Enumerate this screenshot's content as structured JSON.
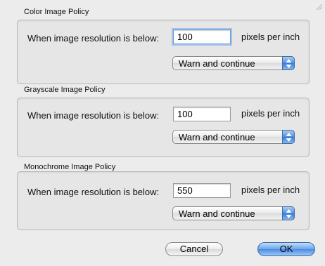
{
  "color_policy": {
    "title": "Color Image Policy",
    "label": "When image resolution is below:",
    "value": "100",
    "unit": "pixels per inch",
    "action": "Warn and continue"
  },
  "grayscale_policy": {
    "title": "Grayscale Image Policy",
    "label": "When image resolution is below:",
    "value": "100",
    "unit": "pixels per inch",
    "action": "Warn and continue"
  },
  "mono_policy": {
    "title": "Monochrome Image Policy",
    "label": "When image resolution is below:",
    "value": "550",
    "unit": "pixels per inch",
    "action": "Warn and continue"
  },
  "buttons": {
    "cancel": "Cancel",
    "ok": "OK"
  },
  "colors": {
    "accent": "#4a8ce2",
    "focus_ring": "#a3c2ea"
  },
  "icons": {
    "popup_arrows": "up-down-arrows-icon",
    "resize": "resize-grip-icon"
  }
}
